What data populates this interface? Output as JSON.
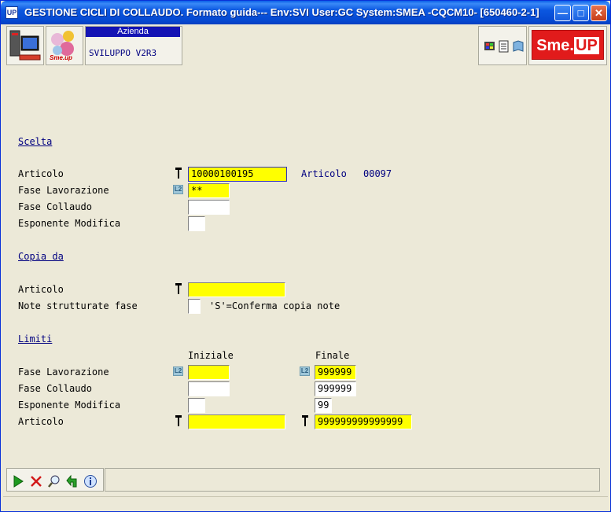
{
  "window": {
    "badge": "UP",
    "title": "GESTIONE CICLI DI COLLAUDO.  Formato guida--- Env:SVI User:GC System:SMEA -CQCM10- [650460-2-1]"
  },
  "header": {
    "azienda_label": "Azienda",
    "azienda_value": "SVILUPPO V2R3",
    "logo_small": "Sme.up",
    "brand_left": "Sme.",
    "brand_right": "UP"
  },
  "scelta": {
    "title": "Scelta",
    "articolo_label": "Articolo",
    "articolo_value": "10000100195",
    "articolo_info_label": "Articolo",
    "articolo_info_value": "00097",
    "fase_lav_label": "Fase Lavorazione",
    "fase_lav_value": "**",
    "fase_coll_label": "Fase Collaudo",
    "fase_coll_value": "",
    "esponente_label": "Esponente Modifica",
    "esponente_value": ""
  },
  "copia": {
    "title": "Copia da",
    "articolo_label": "Articolo",
    "articolo_value": "",
    "note_label": "Note strutturate fase",
    "note_value": "",
    "note_hint": "'S'=Conferma copia note"
  },
  "limiti": {
    "title": "Limiti",
    "col_iniziale": "Iniziale",
    "col_finale": "Finale",
    "fase_lav_label": "Fase Lavorazione",
    "fase_lav_iniziale": "",
    "fase_lav_finale": "999999",
    "fase_coll_label": "Fase Collaudo",
    "fase_coll_iniziale": "",
    "fase_coll_finale": "999999",
    "esponente_label": "Esponente Modifica",
    "esponente_iniziale": "",
    "esponente_finale": "99",
    "articolo_label": "Articolo",
    "articolo_iniziale": "",
    "articolo_finale": "999999999999999"
  },
  "icons": {
    "l2_badge": "L2"
  },
  "colors": {
    "required_field": "#ffff00",
    "section_title": "#000080",
    "titlebar": "#0b57e0"
  }
}
